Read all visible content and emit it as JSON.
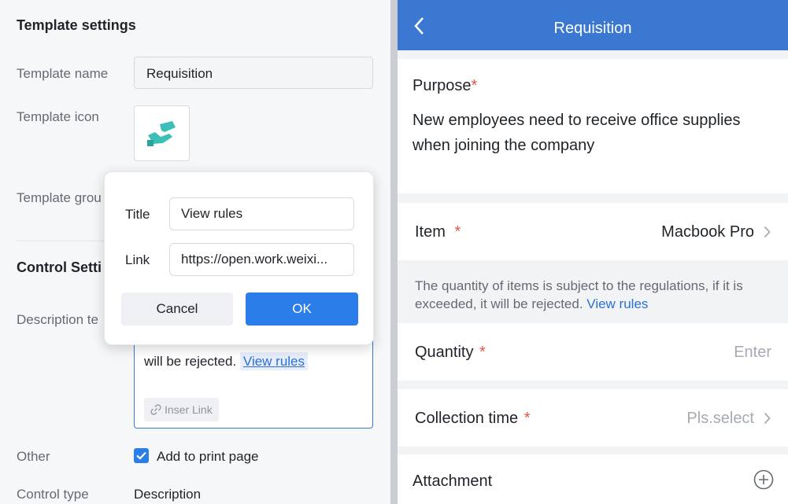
{
  "settings": {
    "title": "Template settings",
    "name_label": "Template name",
    "name_value": "Requisition",
    "icon_label": "Template icon",
    "icon_name": "hand-icon",
    "group_label": "Template grou",
    "control_title": "Control Setti",
    "desc_label": "Description te",
    "desc_text": "will be rejected.",
    "desc_link": "View rules",
    "insert_link": "Inser Link",
    "other_label": "Other",
    "print_label": "Add to print page",
    "print_checked": true,
    "type_label": "Control type",
    "type_value": "Description"
  },
  "modal": {
    "title_label": "Title",
    "title_value": "View rules",
    "link_label": "Link",
    "link_value": "https://open.work.weixi...",
    "cancel": "Cancel",
    "ok": "OK"
  },
  "preview": {
    "header_title": "Requisition",
    "purpose_label": "Purpose",
    "purpose_text": "New employees need to receive office supplies when joining the company",
    "item_label": "Item",
    "item_value": "Macbook Pro",
    "note_text": "The quantity of items is subject to the regulations, if it is exceeded, it will be rejected.",
    "note_link": "View rules",
    "quantity_label": "Quantity",
    "quantity_placeholder": "Enter",
    "collection_label": "Collection time",
    "collection_placeholder": "Pls.select",
    "attachment_label": "Attachment",
    "required_mark": "*"
  },
  "colors": {
    "accent": "#3b78d1",
    "button_blue": "#2b7de9",
    "required_red": "#e5534b",
    "icon_teal": "#3bbfb6"
  }
}
